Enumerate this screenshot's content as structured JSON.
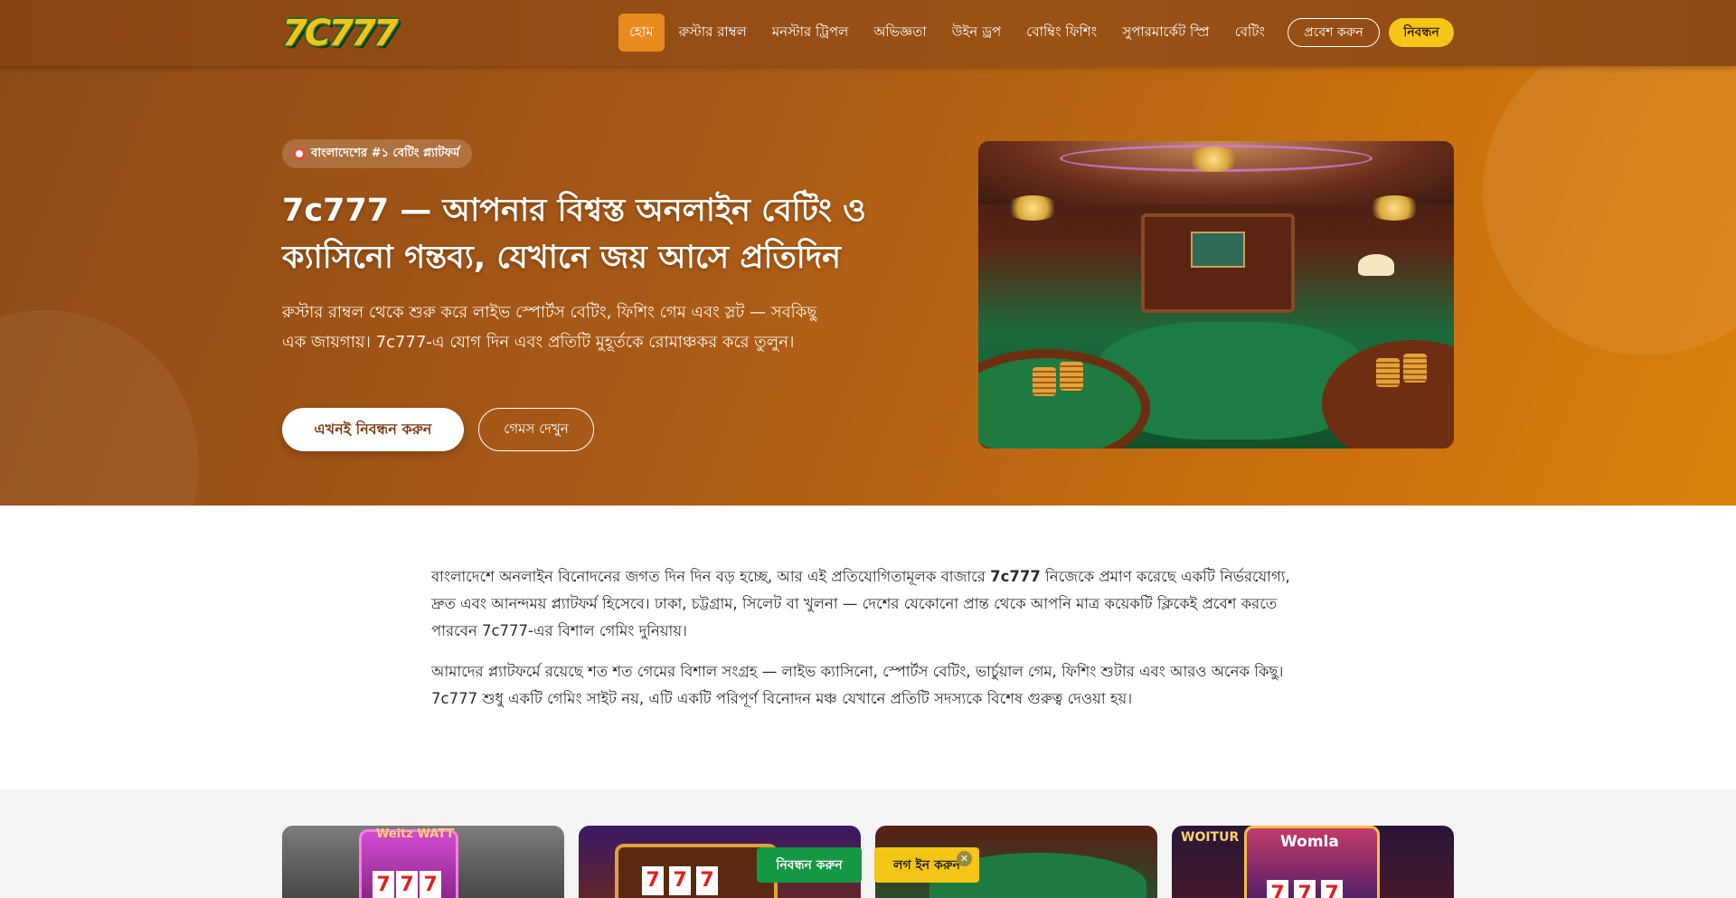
{
  "brand": {
    "logo_text": "7C777"
  },
  "nav": {
    "items": [
      {
        "label": "হোম",
        "active": true
      },
      {
        "label": "রুস্টার রাম্বল"
      },
      {
        "label": "মনস্টার ট্রিপল"
      },
      {
        "label": "অভিজ্ঞতা"
      },
      {
        "label": "উইন ড্রপ"
      },
      {
        "label": "বোম্বিং ফিশিং"
      },
      {
        "label": "সুপারমার্কেট স্প্রি"
      },
      {
        "label": "বেটিং"
      }
    ],
    "login_label": "প্রবেশ করুন",
    "register_label": "নিবন্ধন"
  },
  "hero": {
    "badge": "বাংলাদেশের #১ বেটিং প্ল্যাটফর্ম",
    "title": "7c777 — আপনার বিশ্বস্ত অনলাইন বেটিং ও ক্যাসিনো গন্তব্য, যেখানে জয় আসে প্রতিদিন",
    "description": "রুস্টার রাম্বল থেকে শুরু করে লাইভ স্পোর্টস বেটিং, ফিশিং গেম এবং স্লট — সবকিছু এক জায়গায়। 7c777-এ যোগ দিন এবং প্রতিটি মুহূর্তকে রোমাঞ্চকর করে তুলুন।",
    "primary_button": "এখনই নিবন্ধন করুন",
    "secondary_button": "গেমস দেখুন"
  },
  "content": {
    "p1_before": "বাংলাদেশে অনলাইন বিনোদনের জগত দিন দিন বড় হচ্ছে, আর এই প্রতিযোগিতামূলক বাজারে ",
    "p1_bold": "7c777",
    "p1_after": " নিজেকে প্রমাণ করেছে একটি নির্ভরযোগ্য, দ্রুত এবং আনন্দময় প্ল্যাটফর্ম হিসেবে। ঢাকা, চট্টগ্রাম, সিলেট বা খুলনা — দেশের যেকোনো প্রান্ত থেকে আপনি মাত্র কয়েকটি ক্লিকেই প্রবেশ করতে পারবেন 7c777-এর বিশাল গেমিং দুনিয়ায়।",
    "p2": "আমাদের প্ল্যাটফর্মে রয়েছে শত শত গেমের বিশাল সংগ্রহ — লাইভ ক্যাসিনো, স্পোর্টস বেটিং, ভার্চুয়াল গেম, ফিশিং শুটার এবং আরও অনেক কিছু। 7c777 শুধু একটি গেমিং সাইট নয়, এটি একটি পরিপূর্ণ বিনোদন মঞ্চ যেখানে প্রতিটি সদস্যকে বিশেষ গুরুত্ব দেওয়া হয়।"
  },
  "games": {
    "card1_label": "Weitz WATT",
    "card3_label": "WOITUR",
    "card4_label": "Womla"
  },
  "floating": {
    "register_label": "নিবন্ধন করুন",
    "login_label": "লগ ইন করুন",
    "close_glyph": "✕"
  },
  "colors": {
    "header_bg": "#8b4513",
    "active_nav": "#e98a1f",
    "accent_yellow": "#f5c518",
    "floating_green": "#159844"
  }
}
